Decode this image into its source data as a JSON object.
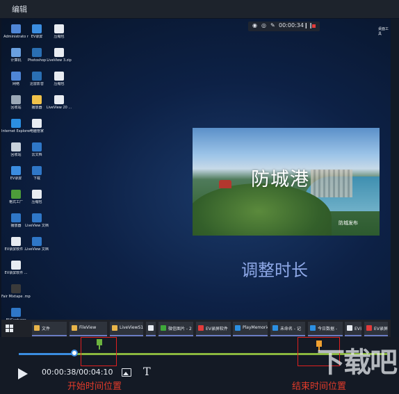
{
  "window": {
    "title": "编辑"
  },
  "desktop": {
    "icons": [
      {
        "label": "Administrato r",
        "color": "#4f86d6"
      },
      {
        "label": "计算机",
        "color": "#6aa0e0"
      },
      {
        "label": "网络",
        "color": "#4f86d6"
      },
      {
        "label": "回收站",
        "color": "#9aa7b6"
      },
      {
        "label": "Internet Explorer",
        "color": "#2b8fe2"
      },
      {
        "label": "回收站",
        "color": "#c8d2dc"
      },
      {
        "label": "EV录屏",
        "color": "#3b8de0"
      },
      {
        "label": "格式工厂",
        "color": "#4d9c3a"
      },
      {
        "label": "播放器",
        "color": "#2f77c7"
      },
      {
        "label": "EV录屏软件 ...",
        "color": "#e8ecf2"
      },
      {
        "label": "EV录屏软件 ...",
        "color": "#e8ecf2"
      },
      {
        "label": "Fair Mixtape .mp4",
        "color": "#3a3a3a"
      },
      {
        "label": "EVCapturer",
        "color": "#2f77c7"
      }
    ],
    "icons_col2": [
      {
        "label": "EV录屏",
        "color": "#3b8de0"
      },
      {
        "label": "Photoshop",
        "color": "#2a6fb3"
      },
      {
        "label": "迅雷影音",
        "color": "#2a6fb3"
      },
      {
        "label": "播放器",
        "color": "#f0c24a"
      },
      {
        "label": "电脑管家",
        "color": "#e8ecf2"
      },
      {
        "label": "云文档",
        "color": "#2f77c7"
      },
      {
        "label": "下载",
        "color": "#2f77c7"
      },
      {
        "label": "压缩包",
        "color": "#e8ecf2"
      },
      {
        "label": "LiveView 文档",
        "color": "#2f77c7"
      },
      {
        "label": "LiveView 文档",
        "color": "#2f77c7"
      }
    ],
    "icons_col3": [
      {
        "label": "压缩包",
        "color": "#e8ecf2"
      },
      {
        "label": "LiveView 3.zip",
        "color": "#e8ecf2"
      },
      {
        "label": "压缩包",
        "color": "#e8ecf2"
      },
      {
        "label": "LiveView 20 ...",
        "color": "#e8ecf2"
      }
    ],
    "right_top_text": "桌面工具",
    "recorder_time": "00:00:34"
  },
  "preview": {
    "photo_caption": "防城港",
    "photo_watermark": "防城发布",
    "overlay_text": "调整时长"
  },
  "taskbar": {
    "items": [
      {
        "label": "文件",
        "color": "#e8b44a"
      },
      {
        "label": "FileView",
        "color": "#e8b44a"
      },
      {
        "label": "LiveViewS1",
        "color": "#e8b44a"
      },
      {
        "label": "",
        "color": "#e8ecf2"
      },
      {
        "label": "微信图片 - 2",
        "color": "#3ea83a"
      },
      {
        "label": "EV录屏软件",
        "color": "#e23b3b"
      },
      {
        "label": "PlayMemories",
        "color": "#2b8fe2"
      },
      {
        "label": "未命名 - 记",
        "color": "#2b8fe2"
      },
      {
        "label": "今日数据 - ",
        "color": "#2b8fe2"
      },
      {
        "label": "EV录屏",
        "color": "#e8ecf2"
      },
      {
        "label": "EV录屏软件",
        "color": "#e23b3b"
      }
    ]
  },
  "editor": {
    "current_time": "00:00:38",
    "total_time": "00:04:10",
    "time_display": "00:00:38/00:04:10",
    "start_label": "开始时间位置",
    "end_label": "结束时间位置",
    "start_flag_color": "#6cb33f",
    "end_flag_color": "#f0a030",
    "progress_fraction": 0.15,
    "watermark_logo": "下载吧"
  }
}
